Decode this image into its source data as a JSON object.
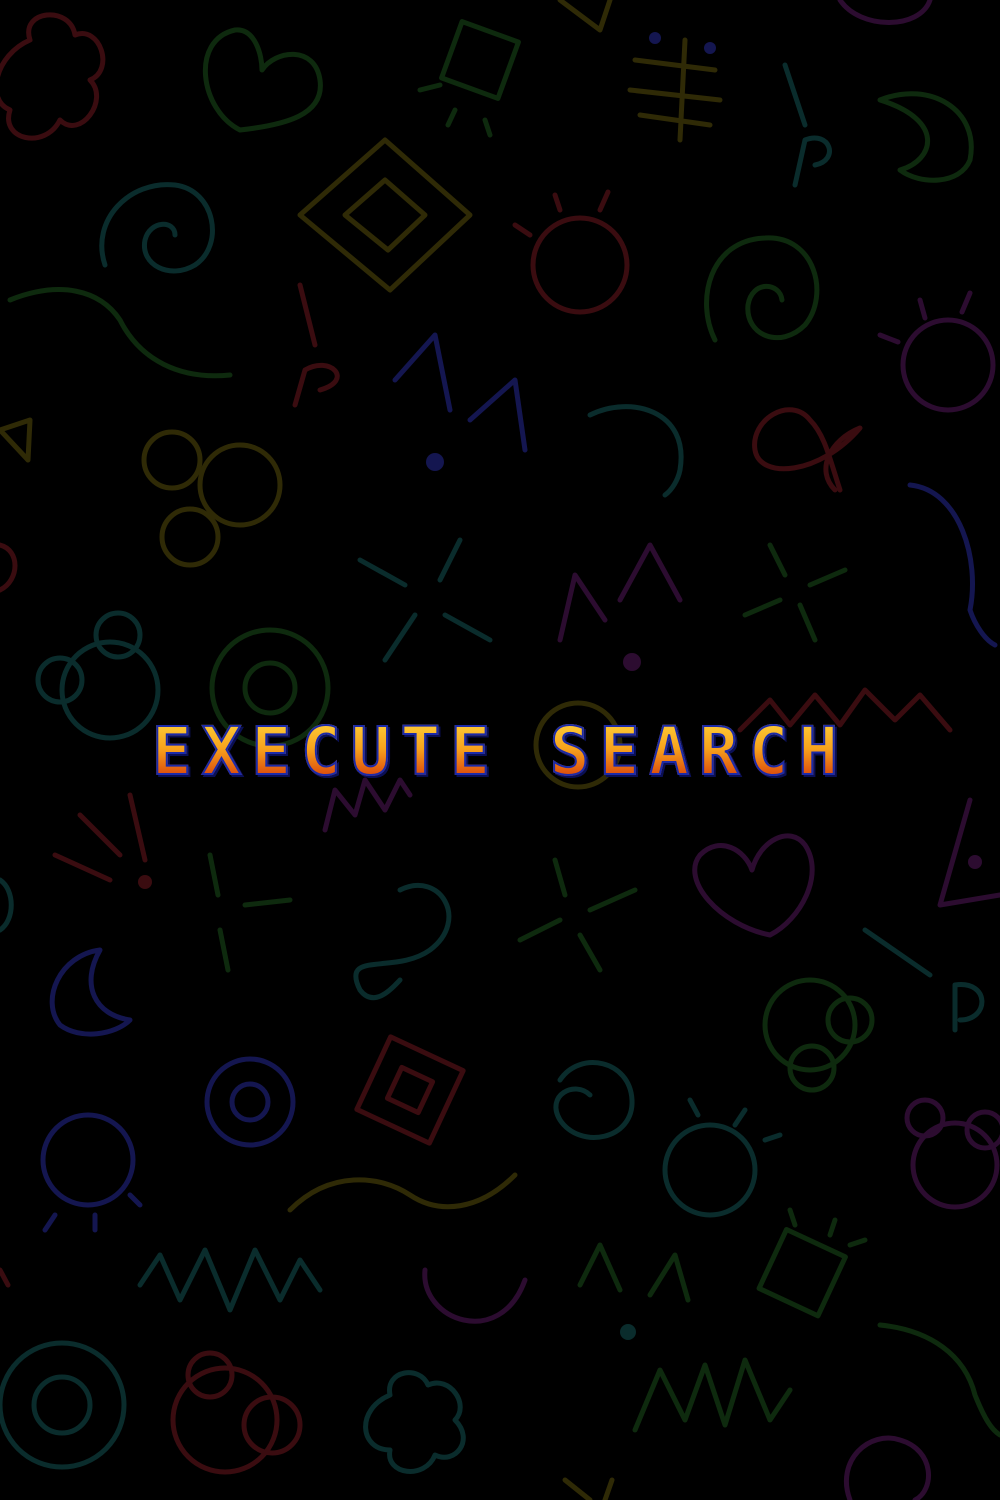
{
  "screen": {
    "title_text": "EXECUTE SEARCH",
    "background_color": "#000000",
    "title_gradient": [
      "#ffd23a",
      "#f7a21c",
      "#e0570e",
      "#c2370a"
    ],
    "title_outline_color": "#1c2aa8"
  },
  "background_icons": [
    "flower-icon",
    "heart-icon",
    "diamond-icon",
    "spiral-icon",
    "crescent-icon",
    "sun-icon",
    "zigzag-icon",
    "target-icon",
    "sparkle-icon",
    "wave-icon",
    "square-icon",
    "bubbles-icon"
  ]
}
